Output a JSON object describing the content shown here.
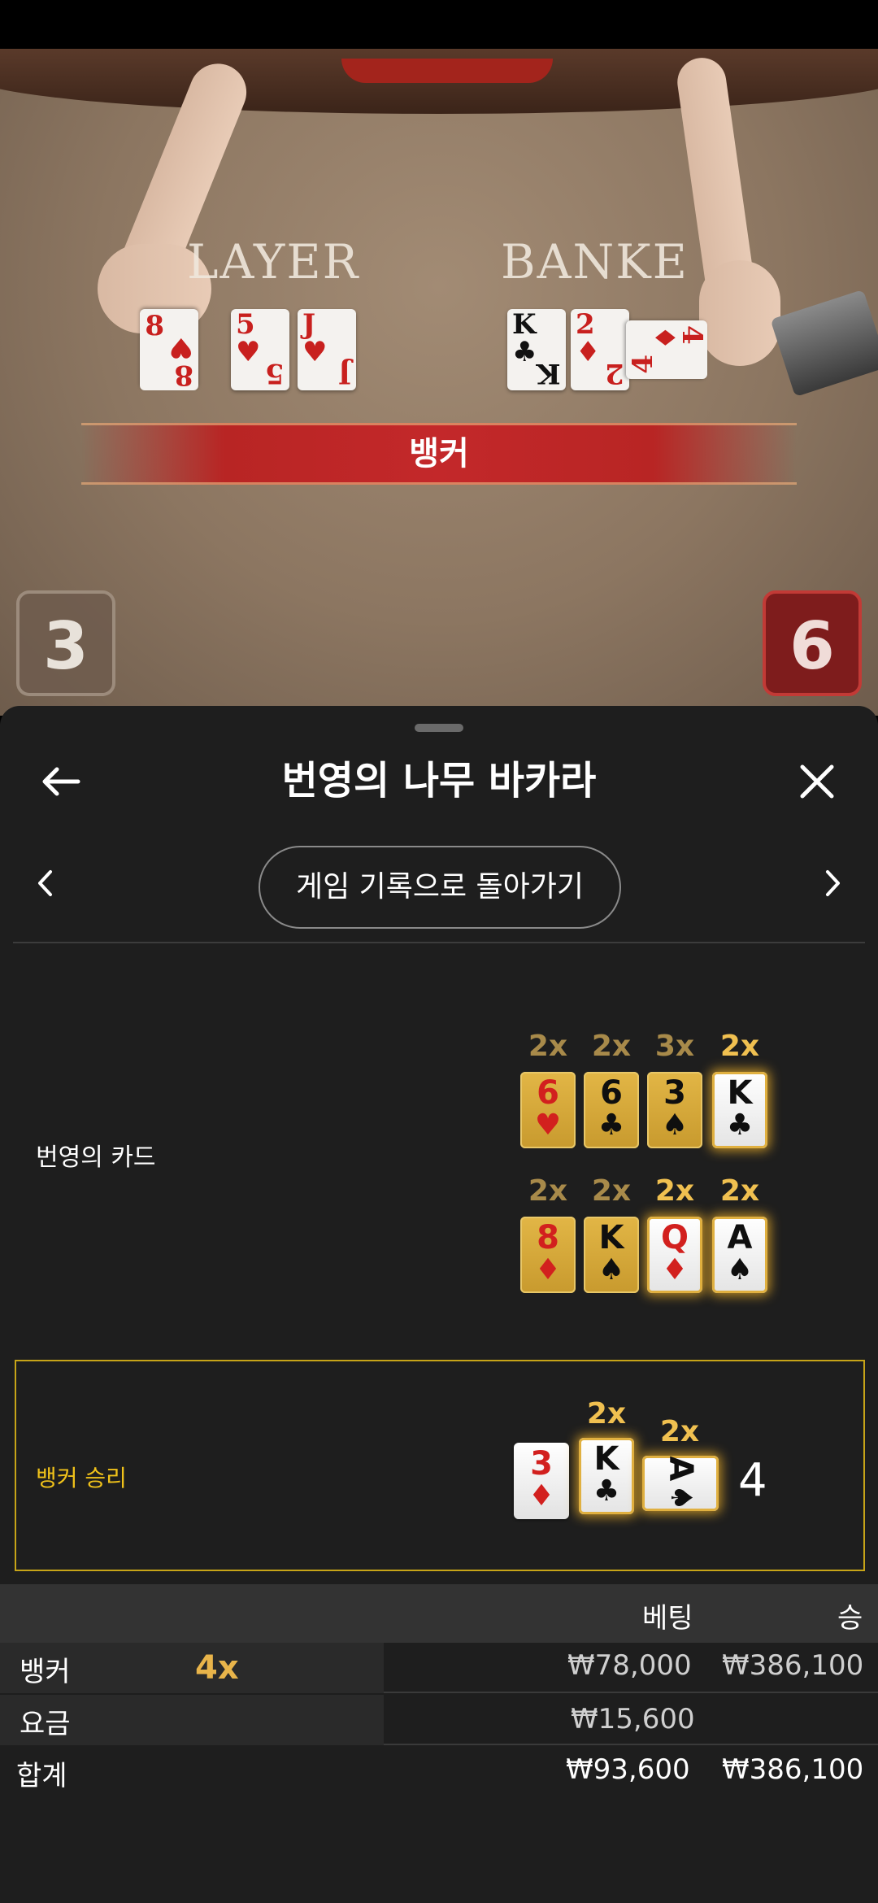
{
  "video": {
    "player_label": "LAYER",
    "banker_label": "BANKE",
    "result_banner": "뱅커",
    "player_score": "3",
    "banker_score": "6",
    "player_cards": [
      {
        "rank": "8",
        "suit": "♥",
        "color": "red"
      },
      {
        "rank": "5",
        "suit": "♥",
        "color": "red"
      },
      {
        "rank": "J",
        "suit": "♥",
        "color": "red"
      }
    ],
    "banker_cards": [
      {
        "rank": "K",
        "suit": "♣",
        "color": "black"
      },
      {
        "rank": "2",
        "suit": "♦",
        "color": "red"
      },
      {
        "rank": "4",
        "suit": "♦",
        "color": "red"
      }
    ]
  },
  "header": {
    "title": "번영의 나무 바카라",
    "back_icon": "arrow-left-icon",
    "close_icon": "close-icon",
    "history_button": "게임 기록으로 돌아가기",
    "prev_icon": "chevron-left-icon",
    "next_icon": "chevron-right-icon"
  },
  "lucky_cards": {
    "label": "번영의 카드",
    "rows": [
      [
        {
          "mult": "2x",
          "rank": "6",
          "suit": "♥",
          "color": "red",
          "style": "gold",
          "mult_style": "dim"
        },
        {
          "mult": "2x",
          "rank": "6",
          "suit": "♣",
          "color": "black",
          "style": "gold",
          "mult_style": "dim"
        },
        {
          "mult": "3x",
          "rank": "3",
          "suit": "♠",
          "color": "black",
          "style": "gold",
          "mult_style": "dim"
        },
        {
          "mult": "2x",
          "rank": "K",
          "suit": "♣",
          "color": "black",
          "style": "white",
          "mult_style": "bright"
        }
      ],
      [
        {
          "mult": "2x",
          "rank": "8",
          "suit": "♦",
          "color": "red",
          "style": "gold",
          "mult_style": "dim"
        },
        {
          "mult": "2x",
          "rank": "K",
          "suit": "♠",
          "color": "black",
          "style": "gold",
          "mult_style": "dim"
        },
        {
          "mult": "2x",
          "rank": "Q",
          "suit": "♦",
          "color": "red",
          "style": "white",
          "mult_style": "bright"
        },
        {
          "mult": "2x",
          "rank": "A",
          "suit": "♠",
          "color": "black",
          "style": "white",
          "mult_style": "bright"
        }
      ]
    ]
  },
  "winner": {
    "label": "뱅커 승리",
    "total": "4",
    "cards": [
      {
        "mult": "",
        "rank": "3",
        "suit": "♦",
        "color": "red",
        "style": "plain"
      },
      {
        "mult": "2x",
        "rank": "K",
        "suit": "♣",
        "color": "black",
        "style": "white"
      },
      {
        "mult": "2x",
        "rank": "A",
        "suit": "♠",
        "color": "black",
        "style": "white",
        "horizontal": true
      }
    ]
  },
  "bets": {
    "headers": {
      "bet": "베팅",
      "win": "승"
    },
    "rows": [
      {
        "name": "뱅커",
        "mult": "4x",
        "bet": "₩78,000",
        "win": "₩386,100"
      },
      {
        "name": "요금",
        "mult": "",
        "bet": "₩15,600",
        "win": ""
      }
    ],
    "total": {
      "name": "합계",
      "bet": "₩93,600",
      "win": "₩386,100"
    }
  }
}
